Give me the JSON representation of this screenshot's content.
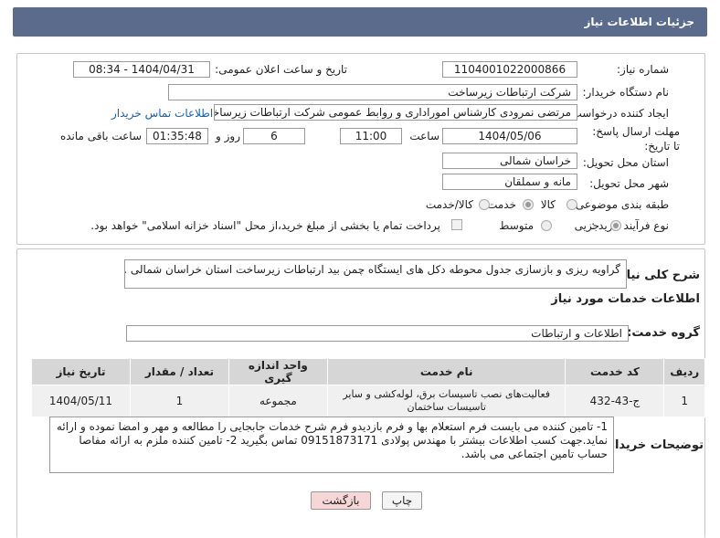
{
  "header": {
    "title": "جزئیات اطلاعات نیاز"
  },
  "form": {
    "need_number": {
      "label": "شماره نیاز:",
      "value": "1104001022000866"
    },
    "announce_datetime": {
      "label": "تاریخ و ساعت اعلان عمومی:",
      "value": "1404/04/31 - 08:34"
    },
    "buyer_device": {
      "label": "نام دستگاه خریدار:",
      "value": "شرکت ارتباطات زیرساخت"
    },
    "request_creator": {
      "label": "ایجاد کننده درخواست:",
      "value": "مرتضی نمرودی کارشناس اموراداری و روابط عمومی شرکت ارتباطات زیرساخت",
      "contact_link": "اطلاعات تماس خریدار"
    },
    "deadline": {
      "label": "مهلت ارسال پاسخ: تا تاریخ:",
      "date": "1404/05/06",
      "time_label": "ساعت",
      "time": "11:00",
      "days": "6",
      "days_label": "روز و",
      "remaining": "01:35:48",
      "remaining_label": "ساعت باقی مانده"
    },
    "delivery_province": {
      "label": "استان محل تحویل:",
      "value": "خراسان شمالی"
    },
    "delivery_city": {
      "label": "شهر محل تحویل:",
      "value": "مانه و سملقان"
    },
    "category": {
      "label": "طبقه بندی موضوعی:",
      "options": [
        "کالا",
        "خدمت",
        "کالا/خدمت"
      ],
      "selected": "خدمت"
    },
    "purchase_type": {
      "label": "نوع فرآیند خرید :",
      "options": [
        "جزیی",
        "متوسط"
      ],
      "selected": "جزیی",
      "treasury_note": "پرداخت تمام یا بخشی از مبلغ خرید،از محل \"اسناد خزانه اسلامی\" خواهد بود."
    }
  },
  "description": {
    "label": "شرح کلی نیاز:",
    "value": "گراویه ریزی و بازسازی جدول  محوطه دکل های ایستگاه چمن بید ارتباطات زیرساخت استان خراسان شمالی ."
  },
  "services": {
    "section_title": "اطلاعات خدمات مورد نیاز",
    "group_label": "گروه خدمت:",
    "group_value": "اطلاعات و ارتباطات",
    "columns": [
      "ردیف",
      "کد خدمت",
      "نام خدمت",
      "واحد اندازه گیری",
      "تعداد / مقدار",
      "تاریخ نیاز"
    ],
    "rows": [
      {
        "row": "1",
        "code": "ج-43-432",
        "name": "فعالیت‌های نصب تاسیسات برق، لوله‌کشی و سایر تاسیسات ساختمان",
        "unit": "مجموعه",
        "qty": "1",
        "date": "1404/05/11"
      }
    ]
  },
  "buyer_notes": {
    "label": "توضیحات خریدار:",
    "value": "1- تامین کننده می بایست فرم استعلام بها و فرم بازدیدو فرم شرح خدمات جابجایی را مطالعه و مهر و امضا نموده و ارائه نماید.جهت کسب اطلاعات بیشتر با مهندس پولادی 09151873171 تماس بگیرید 2- تامین کننده ملزم به ارائه مفاصا حساب تامین اجتماعی می باشد."
  },
  "buttons": {
    "print": "چاپ",
    "back": "بازگشت"
  },
  "colors": {
    "header_bg": "#5a6b8c",
    "link": "#1d5fa8",
    "back_btn_bg": "#f6d6d6"
  }
}
